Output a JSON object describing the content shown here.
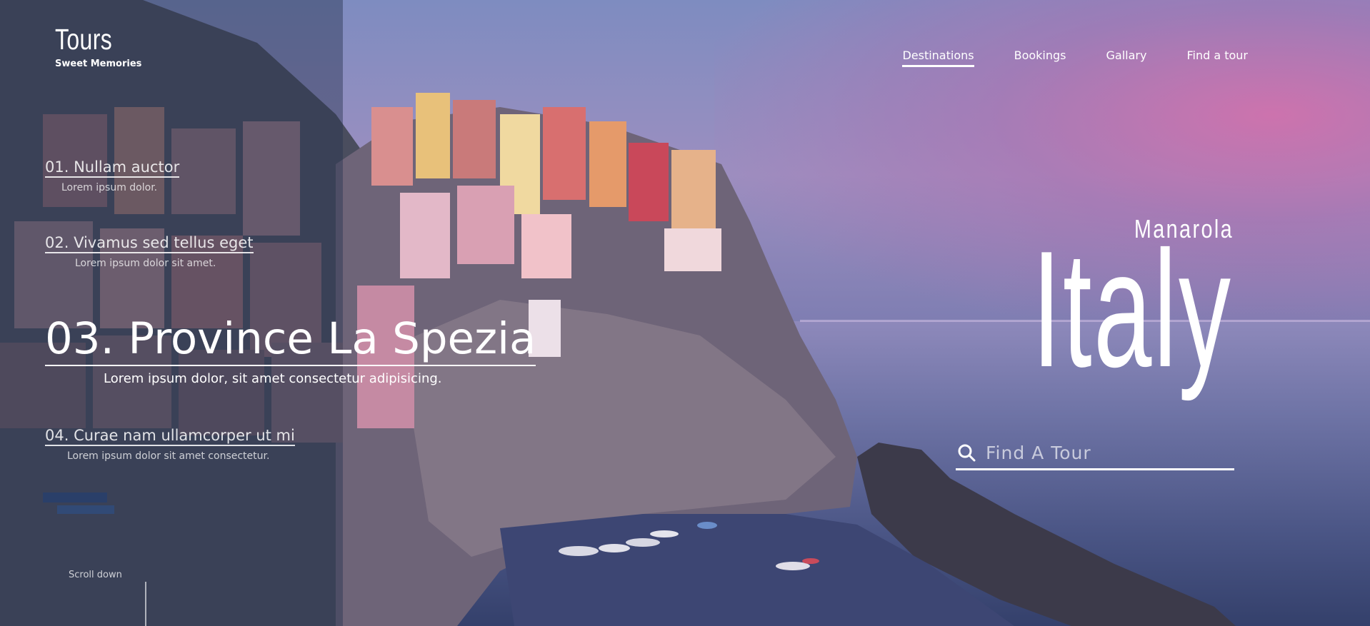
{
  "brand": {
    "title": "Tours",
    "subtitle": "Sweet Memories"
  },
  "nav": {
    "items": [
      {
        "label": "Destinations",
        "active": true
      },
      {
        "label": "Bookings",
        "active": false
      },
      {
        "label": "Gallary",
        "active": false
      },
      {
        "label": "Find a tour",
        "active": false
      }
    ]
  },
  "slides": [
    {
      "title": "01. Nullam auctor",
      "desc": "Lorem ipsum dolor."
    },
    {
      "title": "02. Vivamus sed tellus eget",
      "desc": "Lorem ipsum dolor sit amet."
    },
    {
      "title": "03. Province La Spezia",
      "desc": "Lorem ipsum dolor, sit amet consectetur adipisicing."
    },
    {
      "title": "04. Curae nam ullamcorper ut mi",
      "desc": "Lorem ipsum dolor sit amet consectetur."
    }
  ],
  "active_slide": 3,
  "hero": {
    "place": "Manarola",
    "country": "Italy"
  },
  "search": {
    "placeholder": "Find A Tour"
  },
  "scroll": {
    "label": "Scroll down"
  },
  "background": {
    "icon": "coastal-village-photo"
  },
  "colors": {
    "overlay": "#28325080",
    "accent": "#ffffff"
  }
}
